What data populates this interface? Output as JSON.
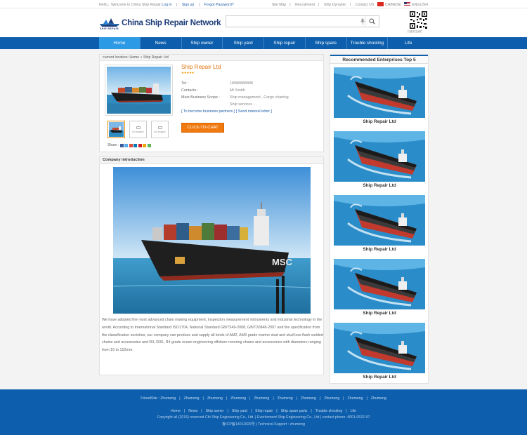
{
  "topbar": {
    "greeting": "Hello，Welcome to China Ship Repair",
    "login": "Log in",
    "signup": "Sign up",
    "forgot": "Forgot Password?",
    "links": [
      "Site Map",
      "Recruitment",
      "Ship Dynamic",
      "Contact US"
    ],
    "lang_cn": "CHINESE",
    "lang_en": "ENGLISH"
  },
  "header": {
    "logo_title": "China Ship Repair Network",
    "logo_sub": "SHIP REPAIR",
    "search_placeholder": "",
    "qr_caption": "扫描关注我们"
  },
  "nav": {
    "items": [
      "Home",
      "News",
      "Ship owner",
      "Ship yard",
      "Ship repair",
      "Ship spare",
      "Trouble shooting",
      "Life"
    ],
    "active": "Home"
  },
  "breadcrumb": "current location: Home » Ship Repair Ltd",
  "profile": {
    "name": "Ship Repair Ltd",
    "stars": "★★★★★",
    "tel_label": "Tel :",
    "tel": "18988888888",
    "contacts_label": "Contacts :",
    "contacts": "Mr Smith",
    "scope_label": "Main Business Scope :",
    "scope_1": "Ship management ,  Cargo charting",
    "scope_2": "Ship services ...",
    "partner_link": "[ To become business partners ]",
    "letter_link": "[ Send internal letter ]",
    "chat_button": "CLICK-TO-CHAT",
    "no_images": "No Images",
    "share_label": "Share :"
  },
  "intro": {
    "heading": "Company introduction",
    "text": "We have adopted the most advanced chain making equipment, inspection measurement instruments and industrial technology in the world. According to International Standard ISO1704, National Standard GB/T549-2008, GB/T20848-2007 and the specification from the classification societies, our company can produce and supply all kinds of AM2, AM3 grade marine stud and stud less flash welded chains and accessories and R3, R3S, R4 grade ocean engineering offshore mooring chains and accessories with diameters ranging from 16 to 152mm.",
    "ship_name_on_hull": "MSC"
  },
  "sidebar": {
    "title": "Recommended Enterprises Top 5",
    "items": [
      "Ship Repair Ltd",
      "Ship Repair Ltd",
      "Ship Repair Ltd",
      "Ship Repair Ltd",
      "Ship Repair Ltd"
    ]
  },
  "footer": {
    "friend_label": "FriendSite :",
    "friends": [
      "Zhumeng",
      "Zhumeng",
      "Zhumeng",
      "Zhumeng",
      "Zhumeng",
      "Zhumeng",
      "Zhumeng",
      "Zhumeng",
      "Zhumeng",
      "Zhumeng"
    ],
    "nav": [
      "Home",
      "News",
      "Ship owner",
      "Ship yard",
      "Ship repair",
      "Ship spare parts",
      "Trouble shooting",
      "Life"
    ],
    "copyright": "Copyright all (2016) reserved Chi Ship Engineering Co., Ltd. | Everhoment Ship Engineering Co., Ltd | contact phone: 4001-0532-97",
    "icp": "鲁ICP备14011829号 | Technical Support : zhumeng"
  },
  "colors": {
    "brand_blue": "#0d5fad",
    "nav_active": "#2d9ae6",
    "accent_orange": "#f07a10"
  }
}
